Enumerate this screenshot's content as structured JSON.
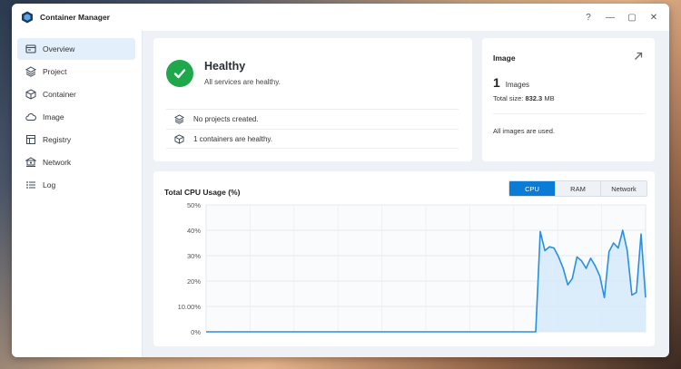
{
  "app": {
    "title": "Container Manager"
  },
  "window_controls": {
    "help": "?",
    "minimize": "—",
    "maximize": "▢",
    "close": "✕"
  },
  "sidebar": {
    "items": [
      {
        "label": "Overview",
        "icon": "overview-icon",
        "active": true
      },
      {
        "label": "Project",
        "icon": "layers-icon",
        "active": false
      },
      {
        "label": "Container",
        "icon": "cube-icon",
        "active": false
      },
      {
        "label": "Image",
        "icon": "cloud-icon",
        "active": false
      },
      {
        "label": "Registry",
        "icon": "registry-icon",
        "active": false
      },
      {
        "label": "Network",
        "icon": "network-icon",
        "active": false
      },
      {
        "label": "Log",
        "icon": "log-list-icon",
        "active": false
      }
    ]
  },
  "health": {
    "title": "Healthy",
    "subtitle": "All services are healthy.",
    "rows": [
      {
        "text": "No projects created.",
        "icon": "layers-icon"
      },
      {
        "text": "1 containers are healthy.",
        "icon": "cube-icon"
      }
    ]
  },
  "image": {
    "title": "Image",
    "count": "1",
    "count_label": "Images",
    "size_label": "Total size:",
    "size_value": "832.3",
    "size_unit": "MB",
    "status": "All images are used."
  },
  "cpu": {
    "title": "Total CPU Usage (%)",
    "tabs": [
      {
        "label": "CPU",
        "active": true
      },
      {
        "label": "RAM",
        "active": false
      },
      {
        "label": "Network",
        "active": false
      }
    ]
  },
  "colors": {
    "accent": "#0a7cd6",
    "healthy": "#1ea84b",
    "line": "#2a8fe0",
    "fill": "#d6e9fa"
  },
  "chart_data": {
    "type": "area",
    "title": "Total CPU Usage (%)",
    "ylim": [
      0,
      50
    ],
    "y_ticks": [
      "0%",
      "10.00%",
      "20%",
      "30%",
      "40%",
      "50%"
    ],
    "grid": true,
    "series": [
      {
        "values": [
          0,
          0,
          0,
          0,
          0,
          0,
          0,
          0,
          0,
          0,
          0,
          0,
          0,
          0,
          0,
          0,
          0,
          0,
          0,
          0,
          0,
          0,
          0,
          0,
          0,
          0,
          0,
          0,
          0,
          0,
          0,
          0,
          0,
          0,
          0,
          0,
          0,
          0,
          0,
          0,
          0,
          0,
          0,
          0,
          0,
          0,
          0,
          0,
          0,
          0,
          0,
          0,
          0,
          0,
          0,
          0,
          0,
          0,
          0,
          0,
          0,
          0,
          0,
          0,
          0,
          0,
          0,
          0,
          0,
          0,
          0,
          0,
          0,
          39.5,
          32,
          33.5,
          33,
          29.5,
          25,
          18.5,
          21,
          29.5,
          28,
          25,
          29,
          26,
          22,
          13.5,
          31.5,
          35,
          33,
          40,
          32,
          14.5,
          15.5,
          38.5,
          13.5
        ]
      }
    ]
  }
}
